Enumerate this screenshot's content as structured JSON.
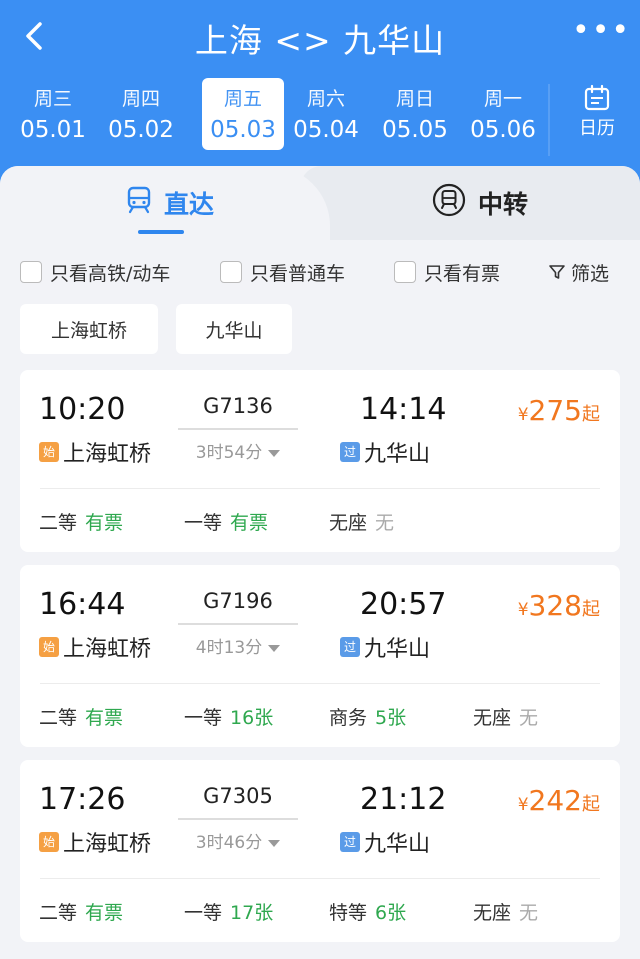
{
  "header": {
    "title": "上海 <> 九华山",
    "back_icon": "chevron-left-icon",
    "more_icon": "more-dots-icon",
    "more_label": "•••"
  },
  "dates": [
    {
      "weekday": "周三",
      "date": "05.01",
      "selected": false
    },
    {
      "weekday": "周四",
      "date": "05.02",
      "selected": false
    },
    {
      "weekday": "周五",
      "date": "05.03",
      "selected": true
    },
    {
      "weekday": "周六",
      "date": "05.04",
      "selected": false
    },
    {
      "weekday": "周日",
      "date": "05.05",
      "selected": false
    },
    {
      "weekday": "周一",
      "date": "05.06",
      "selected": false
    }
  ],
  "calendar": {
    "label": "日历",
    "icon": "calendar-icon"
  },
  "tabs": {
    "direct": {
      "label": "直达",
      "icon": "train-icon"
    },
    "transfer": {
      "label": "中转",
      "icon": "transfer-train-icon"
    }
  },
  "filters": {
    "high_speed": "只看高铁/动车",
    "regular": "只看普通车",
    "available": "只看有票",
    "filter_button": "筛选"
  },
  "stations": {
    "from": "上海虹桥",
    "to": "九华山"
  },
  "badges": {
    "start": "始",
    "pass": "过"
  },
  "price_suffix": "起",
  "currency": "¥",
  "trains": [
    {
      "dep_time": "10:20",
      "arr_time": "14:14",
      "number": "G7136",
      "duration": "3时54分",
      "from": "上海虹桥",
      "to": "九华山",
      "price": "275",
      "seats": [
        {
          "class": "二等",
          "avail": "有票"
        },
        {
          "class": "一等",
          "avail": "有票"
        },
        {
          "class": "无座",
          "avail": "无"
        }
      ]
    },
    {
      "dep_time": "16:44",
      "arr_time": "20:57",
      "number": "G7196",
      "duration": "4时13分",
      "from": "上海虹桥",
      "to": "九华山",
      "price": "328",
      "seats": [
        {
          "class": "二等",
          "avail": "有票"
        },
        {
          "class": "一等",
          "avail": "16张"
        },
        {
          "class": "商务",
          "avail": "5张"
        },
        {
          "class": "无座",
          "avail": "无"
        }
      ]
    },
    {
      "dep_time": "17:26",
      "arr_time": "21:12",
      "number": "G7305",
      "duration": "3时46分",
      "from": "上海虹桥",
      "to": "九华山",
      "price": "242",
      "seats": [
        {
          "class": "二等",
          "avail": "有票"
        },
        {
          "class": "一等",
          "avail": "17张"
        },
        {
          "class": "特等",
          "avail": "6张"
        },
        {
          "class": "无座",
          "avail": "无"
        }
      ]
    }
  ],
  "colors": {
    "header_blue": "#3b8ff3",
    "accent_blue": "#2f86ee",
    "price_orange": "#f1771f",
    "available_green": "#2fa84f",
    "unavailable_gray": "#aaaaaa"
  }
}
